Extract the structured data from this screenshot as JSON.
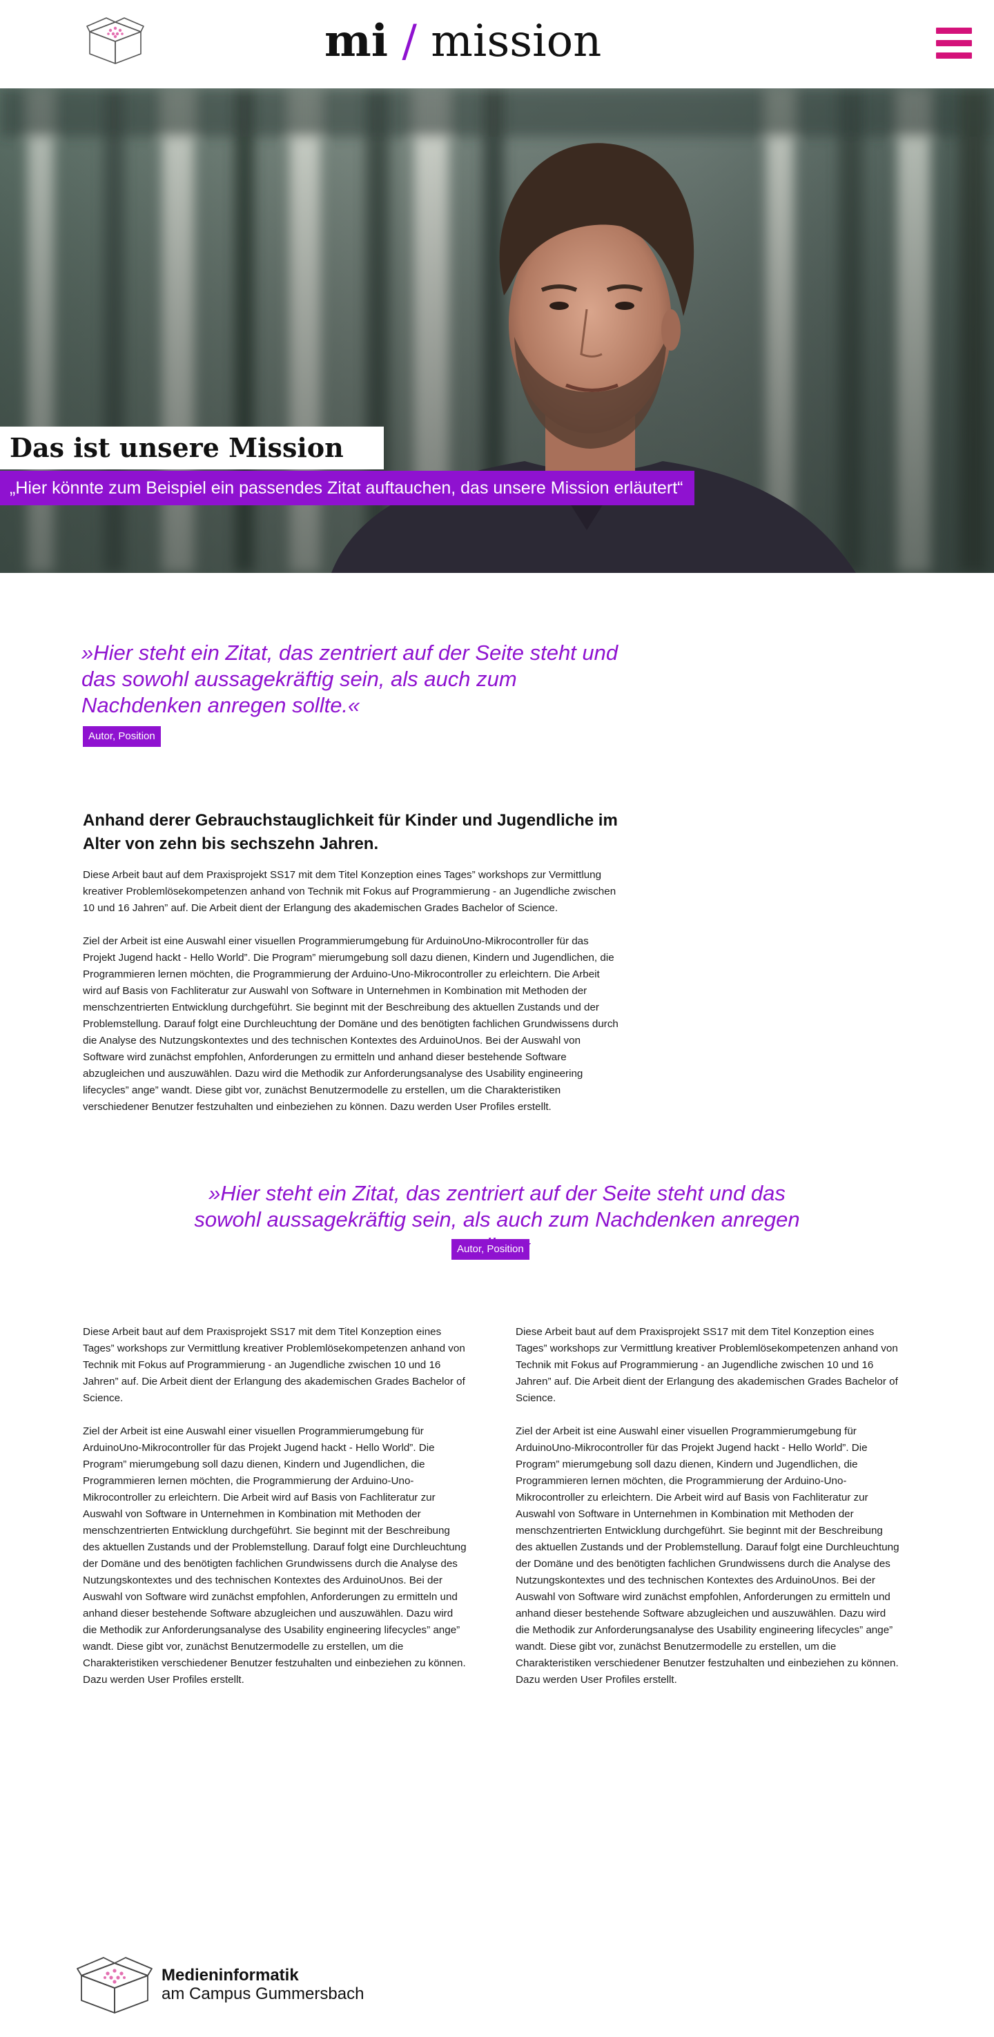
{
  "header": {
    "brand_mi": "mi",
    "brand_slash": "/",
    "brand_mission": "mission",
    "logo_icon": "box-icon",
    "menu_icon": "hamburger-menu-icon"
  },
  "hero": {
    "title": "Das ist unsere Mission",
    "quote": "„Hier könnte zum Beispiel ein passendes Zitat auftauchen, das unsere Mission erläutert“"
  },
  "quote1": {
    "text": "»Hier steht ein Zitat, das zentriert auf der Seite steht und das sowohl aussagekräftig sein, als auch zum Nachdenken anregen sollte.«",
    "author": "Autor, Position"
  },
  "article": {
    "lead": "Anhand derer Gebrauchstauglichkeit für Kinder und Jugendliche im Alter von zehn bis sechszehn Jahren.",
    "p1": "Diese Arbeit baut auf dem Praxisprojekt SS17 mit dem Titel Konzeption eines Tages” workshops zur Vermittlung kreativer Problemlösekompetenzen anhand von Technik mit Fokus auf Programmierung - an Jugendliche zwischen 10 und 16 Jahren” auf. Die Arbeit dient der Erlangung des akademischen Grades Bachelor of Science.",
    "p2": "Ziel der Arbeit ist eine Auswahl einer visuellen Programmierumgebung für ArduinoUno-Mikrocontroller für das Projekt Jugend hackt - Hello World”. Die Program” mierumgebung soll dazu dienen, Kindern und Jugendlichen, die Programmieren lernen möchten, die Programmierung der Arduino-Uno-Mikrocontroller zu erleichtern. Die Arbeit wird auf Basis von Fachliteratur zur Auswahl von Software in Unternehmen in Kombination mit Methoden der menschzentrierten Entwicklung durchgeführt. Sie beginnt mit der Beschreibung des aktuellen Zustands und der Problemstellung. Darauf folgt eine Durchleuchtung der Domäne und des benötigten fachlichen Grundwissens durch die Analyse des Nutzungskontextes und des technischen Kontextes des ArduinoUnos. Bei der Auswahl von Software wird zunächst empfohlen, Anforderungen zu ermitteln und anhand dieser bestehende Software abzugleichen und auszuwählen. Dazu wird die Methodik zur Anforderungsanalyse des Usability engineering lifecycles” ange” wandt. Diese gibt vor, zunächst Benutzermodelle zu erstellen, um die Charakteristiken verschiedener Benutzer festzuhalten und einbeziehen zu können. Dazu werden User Profiles erstellt."
  },
  "quote2": {
    "text": "»Hier steht ein Zitat, das zentriert auf der Seite steht und das sowohl aussagekräftig sein, als auch zum Nachdenken anregen sollte.«",
    "author": "Autor, Position"
  },
  "columns": [
    {
      "p1": "Diese Arbeit baut auf dem Praxisprojekt SS17 mit dem Titel Konzeption eines Tages” workshops zur Vermittlung kreativer Problemlösekompetenzen anhand von Technik mit Fokus auf Programmierung - an Jugendliche zwischen 10 und 16 Jahren” auf. Die Arbeit dient der Erlangung des akademischen Grades Bachelor of Science.",
      "p2": "Ziel der Arbeit ist eine Auswahl einer visuellen Programmierumgebung für ArduinoUno-Mikrocontroller für das Projekt Jugend hackt - Hello World”. Die Program” mierumgebung soll dazu dienen, Kindern und Jugendlichen, die Programmieren lernen möchten, die Programmierung der Arduino-Uno-Mikrocontroller zu erleichtern. Die Arbeit wird auf Basis von Fachliteratur zur Auswahl von Software in Unternehmen in Kombination mit Methoden der menschzentrierten Entwicklung durchgeführt. Sie beginnt mit der Beschreibung des aktuellen Zustands und der Problemstellung. Darauf folgt eine Durchleuchtung der Domäne und des benötigten fachlichen Grundwissens durch die Analyse des Nutzungskontextes und des technischen Kontextes des ArduinoUnos. Bei der Auswahl von Software wird zunächst empfohlen, Anforderungen zu ermitteln und anhand dieser bestehende Software abzugleichen und auszuwählen. Dazu wird die Methodik zur Anforderungsanalyse des Usability engineering lifecycles” ange” wandt. Diese gibt vor, zunächst Benutzermodelle zu erstellen, um die Charakteristiken verschiedener Benutzer festzuhalten und einbeziehen zu können. Dazu werden User Profiles erstellt."
    },
    {
      "p1": "Diese Arbeit baut auf dem Praxisprojekt SS17 mit dem Titel Konzeption eines Tages” workshops zur Vermittlung kreativer Problemlösekompetenzen anhand von Technik mit Fokus auf Programmierung - an Jugendliche zwischen 10 und 16 Jahren” auf. Die Arbeit dient der Erlangung des akademischen Grades Bachelor of Science.",
      "p2": "Ziel der Arbeit ist eine Auswahl einer visuellen Programmierumgebung für ArduinoUno-Mikrocontroller für das Projekt Jugend hackt - Hello World”. Die Program” mierumgebung soll dazu dienen, Kindern und Jugendlichen, die Programmieren lernen möchten, die Programmierung der Arduino-Uno-Mikrocontroller zu erleichtern. Die Arbeit wird auf Basis von Fachliteratur zur Auswahl von Software in Unternehmen in Kombination mit Methoden der menschzentrierten Entwicklung durchgeführt. Sie beginnt mit der Beschreibung des aktuellen Zustands und der Problemstellung. Darauf folgt eine Durchleuchtung der Domäne und des benötigten fachlichen Grundwissens durch die Analyse des Nutzungskontextes und des technischen Kontextes des ArduinoUnos. Bei der Auswahl von Software wird zunächst empfohlen, Anforderungen zu ermitteln und anhand dieser bestehende Software abzugleichen und auszuwählen. Dazu wird die Methodik zur Anforderungsanalyse des Usability engineering lifecycles” ange” wandt. Diese gibt vor, zunächst Benutzermodelle zu erstellen, um die Charakteristiken verschiedener Benutzer festzuhalten und einbeziehen zu können. Dazu werden User Profiles erstellt."
    }
  ],
  "footer": {
    "line1": "Medieninformatik",
    "line2": "am Campus Gummersbach",
    "logo_icon": "box-icon"
  },
  "colors": {
    "accent_purple": "#8f12d0",
    "menu_pink": "#d4127a"
  }
}
